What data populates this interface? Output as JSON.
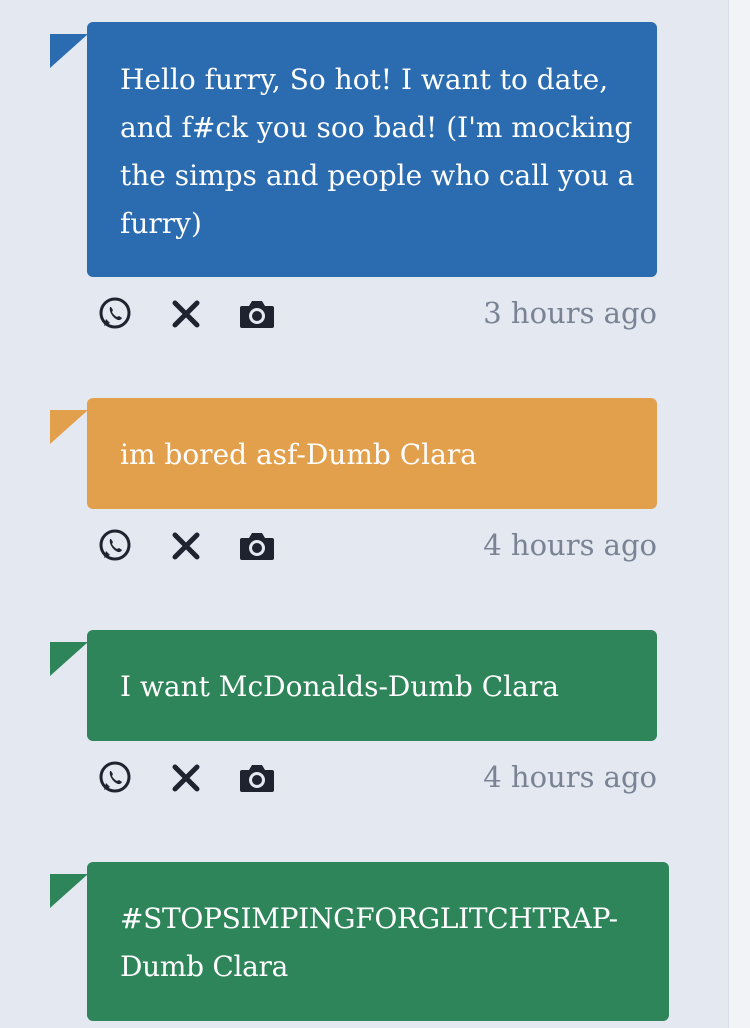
{
  "posts": [
    {
      "text": "Hello furry, So hot! I want to date, and f#ck you soo bad! (I'm mocking the simps and people who call you a furry)",
      "time": "3 hours ago",
      "color": "#2b6cb0"
    },
    {
      "text": "im bored asf-Dumb Clara",
      "time": "4 hours ago",
      "color": "#e29f4c"
    },
    {
      "text": "I want McDonalds-Dumb Clara",
      "time": "4 hours ago",
      "color": "#2f855a"
    },
    {
      "text": "#STOPSIMPINGFORGLITCHTRAP-Dumb Clara",
      "time": "",
      "color": "#2f855a"
    }
  ],
  "share_icons": [
    "whatsapp-icon",
    "x-icon",
    "camera-icon"
  ]
}
